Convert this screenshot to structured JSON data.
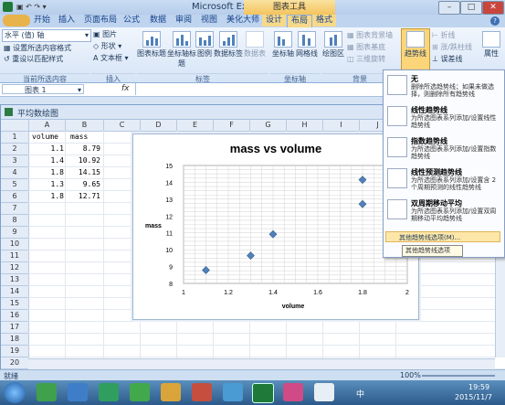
{
  "window": {
    "app_title": "Microsoft Excel",
    "context_tab_group": "图表工具"
  },
  "tabs": [
    "开始",
    "插入",
    "页面布局",
    "公式",
    "数据",
    "审阅",
    "视图",
    "美化大师",
    "设计",
    "布局",
    "格式"
  ],
  "active_tab": "布局",
  "ribbon": {
    "selection_box": "水平 (值) 轴",
    "format_selection": "设置所选内容格式",
    "reset_style": "重设以匹配样式",
    "current_selection_group": "当前所选内容",
    "insert_items": [
      "图片",
      "形状",
      "文本框"
    ],
    "insert_group": "插入",
    "label_buttons": [
      "图表标题",
      "坐标轴标题",
      "图例",
      "数据标签",
      "数据表"
    ],
    "labels_group": "标签",
    "axis_buttons": [
      "坐标轴",
      "网格线"
    ],
    "axes_group": "坐标轴",
    "background_buttons": [
      "绘图区"
    ],
    "background_small": [
      "图表背景墙",
      "图表基底",
      "三维旋转"
    ],
    "background_group": "背景",
    "trendline_button": "趋势线",
    "analysis_small": [
      "折线",
      "涨/跌柱线",
      "误差线"
    ],
    "properties": "属性"
  },
  "formula_bar": {
    "name_box": "图表 1",
    "fx": "fx",
    "value": ""
  },
  "sheet": {
    "title": "平均数绘图",
    "columns": [
      "A",
      "B",
      "C",
      "D",
      "E",
      "F",
      "G",
      "H",
      "I",
      "J"
    ],
    "rows": [
      "1",
      "2",
      "3",
      "4",
      "5",
      "6",
      "7",
      "8",
      "9",
      "10",
      "11",
      "12",
      "13",
      "14",
      "15",
      "16",
      "17",
      "18",
      "19",
      "20"
    ],
    "headers": [
      "volume",
      "mass"
    ],
    "data": [
      [
        "1.1",
        "8.79"
      ],
      [
        "1.4",
        "10.92"
      ],
      [
        "1.8",
        "14.15"
      ],
      [
        "1.3",
        "9.65"
      ],
      [
        "1.8",
        "12.71"
      ]
    ]
  },
  "chart_data": {
    "type": "scatter",
    "title": "mass vs volume",
    "xlabel": "volume",
    "ylabel": "mass",
    "xlim": [
      1,
      2
    ],
    "ylim": [
      8,
      15
    ],
    "xticks": [
      "1",
      "1.2",
      "1.4",
      "1.6",
      "1.8",
      "2"
    ],
    "yticks": [
      "8",
      "9",
      "10",
      "11",
      "12",
      "13",
      "14",
      "15"
    ],
    "grid": true,
    "x": [
      1.1,
      1.4,
      1.8,
      1.3,
      1.8
    ],
    "y": [
      8.79,
      10.92,
      14.15,
      9.65,
      12.71
    ],
    "marker_color": "#4f81bd"
  },
  "trendline_menu": {
    "items": [
      {
        "title": "无",
        "desc": "删除所选趋势线；如果未做选择，则删除所有趋势线"
      },
      {
        "title": "线性趋势线",
        "desc": "为所选图表系列添加/设置线性趋势线"
      },
      {
        "title": "指数趋势线",
        "desc": "为所选图表系列添加/设置指数趋势线"
      },
      {
        "title": "线性预测趋势线",
        "desc": "为所选图表系列添加/设置含 2 个周期预测的线性趋势线"
      },
      {
        "title": "双周期移动平均",
        "desc": "为所选图表系列添加/设置双周期移动平均趋势线"
      }
    ],
    "more": "其他趋势线选项(M)...",
    "tooltip": "其他趋势线选项"
  },
  "status": {
    "left": "就绪",
    "zoom": "100%"
  },
  "taskbar": {
    "lang": "中",
    "time": "19:59",
    "date": "2015/11/7"
  }
}
